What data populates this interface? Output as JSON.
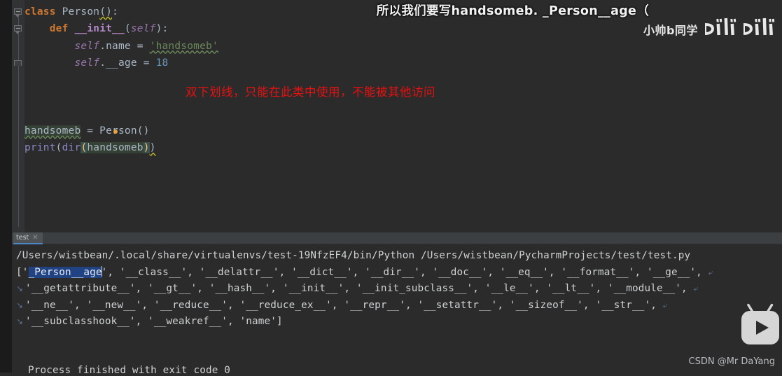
{
  "editor": {
    "code_lines": [
      {
        "id": "line-class-person",
        "tokens": [
          {
            "t": "class",
            "c": "kw"
          },
          {
            "t": " ",
            "c": "plain"
          },
          {
            "t": "Person",
            "c": "clsname"
          },
          {
            "t": "()",
            "c": "typo-warn"
          },
          {
            "t": ":",
            "c": "plain"
          }
        ]
      },
      {
        "id": "line-def-init",
        "tokens": [
          {
            "t": "    ",
            "c": "plain"
          },
          {
            "t": "def",
            "c": "kw"
          },
          {
            "t": " ",
            "c": "plain"
          },
          {
            "t": "__init__",
            "c": "fnname"
          },
          {
            "t": "(",
            "c": "plain"
          },
          {
            "t": "self",
            "c": "selfkw"
          },
          {
            "t": "):",
            "c": "plain"
          }
        ]
      },
      {
        "id": "line-self-name",
        "tokens": [
          {
            "t": "        ",
            "c": "plain"
          },
          {
            "t": "self",
            "c": "selfkw"
          },
          {
            "t": ".name = ",
            "c": "plain"
          },
          {
            "t": "'handsomeb'",
            "c": "str typo"
          }
        ]
      },
      {
        "id": "line-self-age",
        "tokens": [
          {
            "t": "        ",
            "c": "plain"
          },
          {
            "t": "self",
            "c": "selfkw"
          },
          {
            "t": ".__age = ",
            "c": "plain"
          },
          {
            "t": "18",
            "c": "num"
          }
        ]
      },
      {
        "id": "line-blank-1",
        "tokens": []
      },
      {
        "id": "line-blank-2",
        "tokens": []
      },
      {
        "id": "line-blank-3",
        "tokens": []
      },
      {
        "id": "line-instance",
        "tokens": [
          {
            "t": "handsomeb",
            "c": "plain occur-hl typo"
          },
          {
            "t": " = ",
            "c": "plain"
          },
          {
            "t": "Person()",
            "c": "plain"
          }
        ]
      },
      {
        "id": "line-print-dir",
        "tokens": [
          {
            "t": "print",
            "c": "builtin"
          },
          {
            "t": "(",
            "c": "plain"
          },
          {
            "t": "dir",
            "c": "builtin"
          },
          {
            "t": "(",
            "c": "brkhl"
          },
          {
            "t": "handsomeb",
            "c": "plain occur-hl"
          },
          {
            "t": ")",
            "c": "brkhl"
          },
          {
            "t": ")",
            "c": "typo-warn"
          }
        ]
      }
    ],
    "annotation_red": "双下划线，只能在此类中使用，不能被其他访问"
  },
  "overlay": {
    "subtitle": "所以我们要写handsomeb. _Person__age（",
    "channel_name": "小帅b同学",
    "wordmark": "bilibili",
    "mascot_icon": "bilibili-tv-play-icon"
  },
  "console": {
    "tab": {
      "label": "test",
      "close_icon": "close-icon"
    },
    "lines": [
      {
        "id": "console-cmd-line",
        "wrap": false,
        "segments": [
          {
            "t": "/Users/wistbean/.local/share/virtualenvs/test-19NfzEF4/bin/Python /Users/wistbean/PycharmProjects/test/test.py",
            "c": ""
          }
        ]
      },
      {
        "id": "console-out-line-1",
        "wrap": false,
        "segments": [
          {
            "t": "['",
            "c": ""
          },
          {
            "t": "_Person__age",
            "c": "sel-hl"
          },
          {
            "t": "|",
            "c": "caret"
          },
          {
            "t": "', '__class__', '__delattr__', '__dict__', '__dir__', '__doc__', '__eq__', '__format__', '__ge__', ",
            "c": ""
          },
          {
            "t": "⤶",
            "c": "eol"
          }
        ]
      },
      {
        "id": "console-out-line-2",
        "wrap": true,
        "segments": [
          {
            "t": "'__getattribute__', '__gt__', '__hash__', '__init__', '__init_subclass__', '__le__', '__lt__', '__module__', ",
            "c": ""
          },
          {
            "t": "⤶",
            "c": "eol"
          }
        ]
      },
      {
        "id": "console-out-line-3",
        "wrap": true,
        "segments": [
          {
            "t": "'__ne__', '__new__', '__reduce__', '__reduce_ex__', '__repr__', '__setattr__', '__sizeof__', '__str__', ",
            "c": ""
          },
          {
            "t": "⤶",
            "c": "eol"
          }
        ]
      },
      {
        "id": "console-out-line-4",
        "wrap": true,
        "segments": [
          {
            "t": "'__subclasshook__', '__weakref__', 'name']",
            "c": ""
          }
        ]
      }
    ],
    "process_finished": "Process finished with exit code 0"
  },
  "watermark": {
    "csdn": "CSDN @Mr DaYang"
  },
  "colors": {
    "editor_bg": "#2b2b2b",
    "gutter_bg": "#313335",
    "keyword": "#cc7832",
    "string": "#6a8759",
    "number": "#6897bb",
    "self": "#9876aa",
    "builtin": "#8888c6",
    "function": "#b389c5",
    "default_text": "#a9b7c6",
    "red_annotation": "#e81010",
    "tab_accent": "#4a88c7",
    "selection": "#214283"
  }
}
